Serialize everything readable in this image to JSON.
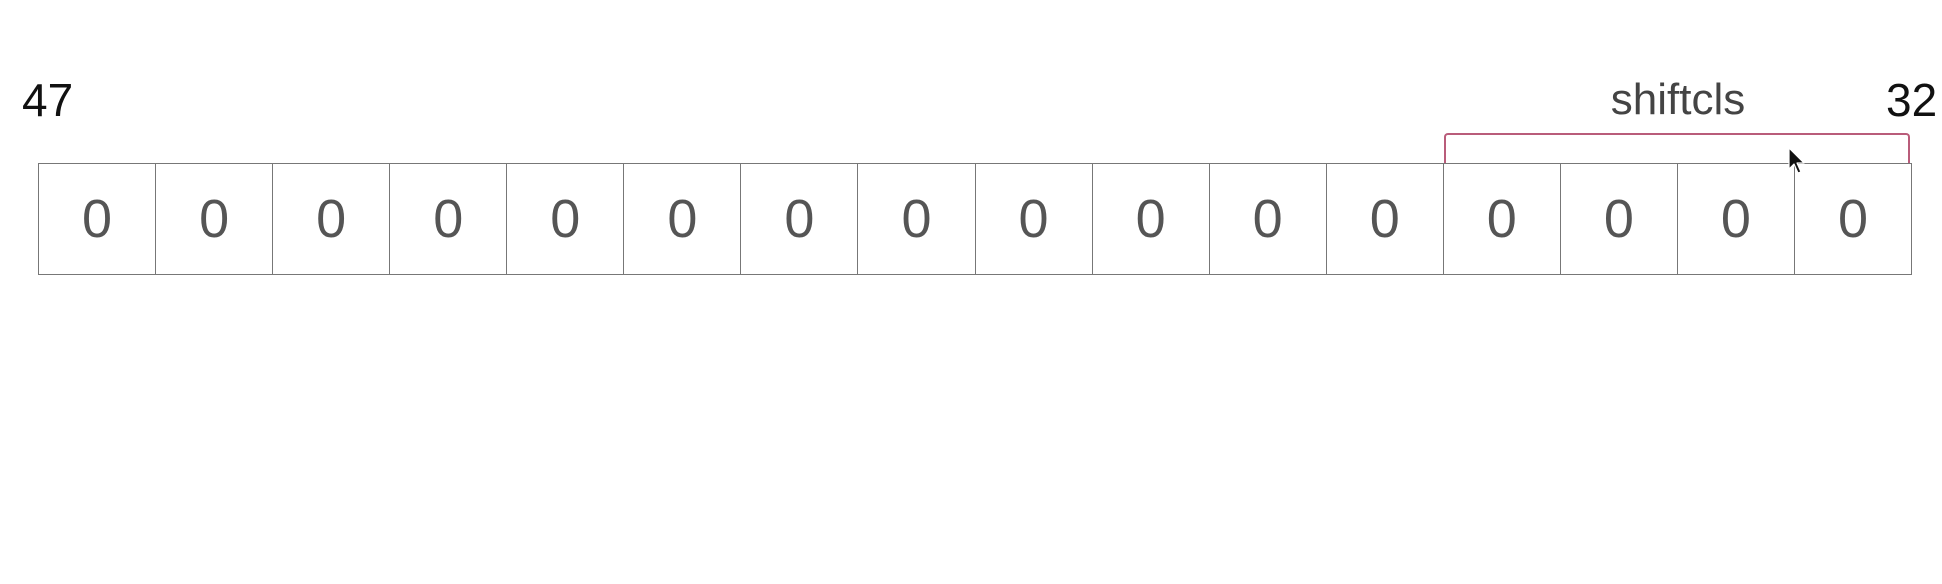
{
  "msb_label": "47",
  "lsb_label": "32",
  "field": {
    "label": "shiftcls",
    "accent_color": "#b95c7a"
  },
  "bits": [
    "0",
    "0",
    "0",
    "0",
    "0",
    "0",
    "0",
    "0",
    "0",
    "0",
    "0",
    "0",
    "0",
    "0",
    "0",
    "0"
  ],
  "cursor_icon": "mouse-pointer-icon"
}
